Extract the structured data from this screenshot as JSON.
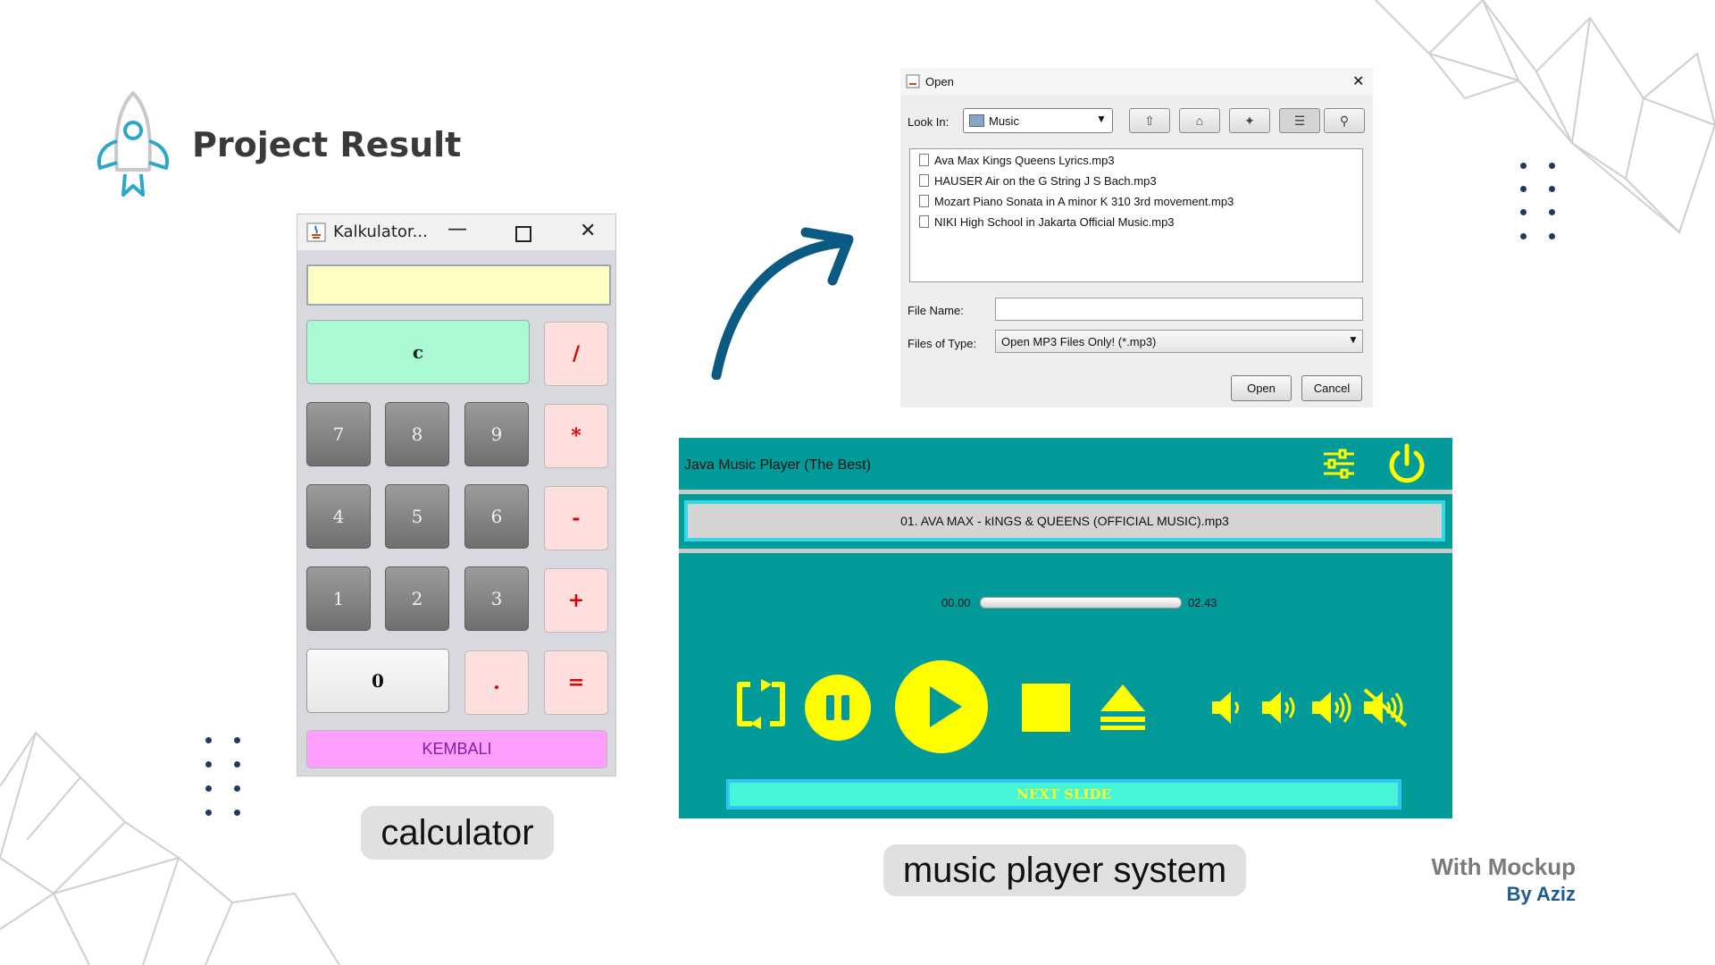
{
  "header": {
    "title": "Project Result",
    "icon": "rocket-icon"
  },
  "calculator": {
    "window_title": "Kalkulator...",
    "display_value": "",
    "keys": {
      "clear": "c",
      "divide": "/",
      "multiply": "*",
      "minus": "-",
      "plus": "+",
      "equals": "=",
      "seven": "7",
      "eight": "8",
      "nine": "9",
      "four": "4",
      "five": "5",
      "six": "6",
      "one": "1",
      "two": "2",
      "three": "3",
      "zero": "0",
      "dot": ".",
      "back": "KEMBALI"
    },
    "caption": "calculator"
  },
  "open_dialog": {
    "title": "Open",
    "look_in_label": "Look In:",
    "look_in_value": "Music",
    "files": [
      "Ava Max  Kings  Queens Lyrics.mp3",
      "HAUSER Air on the G String J S Bach.mp3",
      "Mozart Piano Sonata in A minor K 310 3rd movement.mp3",
      "NIKI  High School in Jakarta Official Music.mp3"
    ],
    "file_name_label": "File Name:",
    "file_name_value": "",
    "files_of_type_label": "Files of Type:",
    "files_of_type_value": "Open MP3 Files Only! (*.mp3)",
    "open_label": "Open",
    "cancel_label": "Cancel"
  },
  "player": {
    "title": "Java Music Player (The Best)",
    "now_playing": "01. AVA MAX - kINGS & QUEENS (OFFICIAL MUSIC).mp3",
    "elapsed": "00.00",
    "total": "02.43",
    "progress": 0,
    "next_slide_label": "NEXT SLIDE",
    "caption": "music player system",
    "accent_color": "#ffff00",
    "background_color": "#039a9a"
  },
  "branding": {
    "line1": "With Mockup",
    "line2": "By Aziz"
  }
}
